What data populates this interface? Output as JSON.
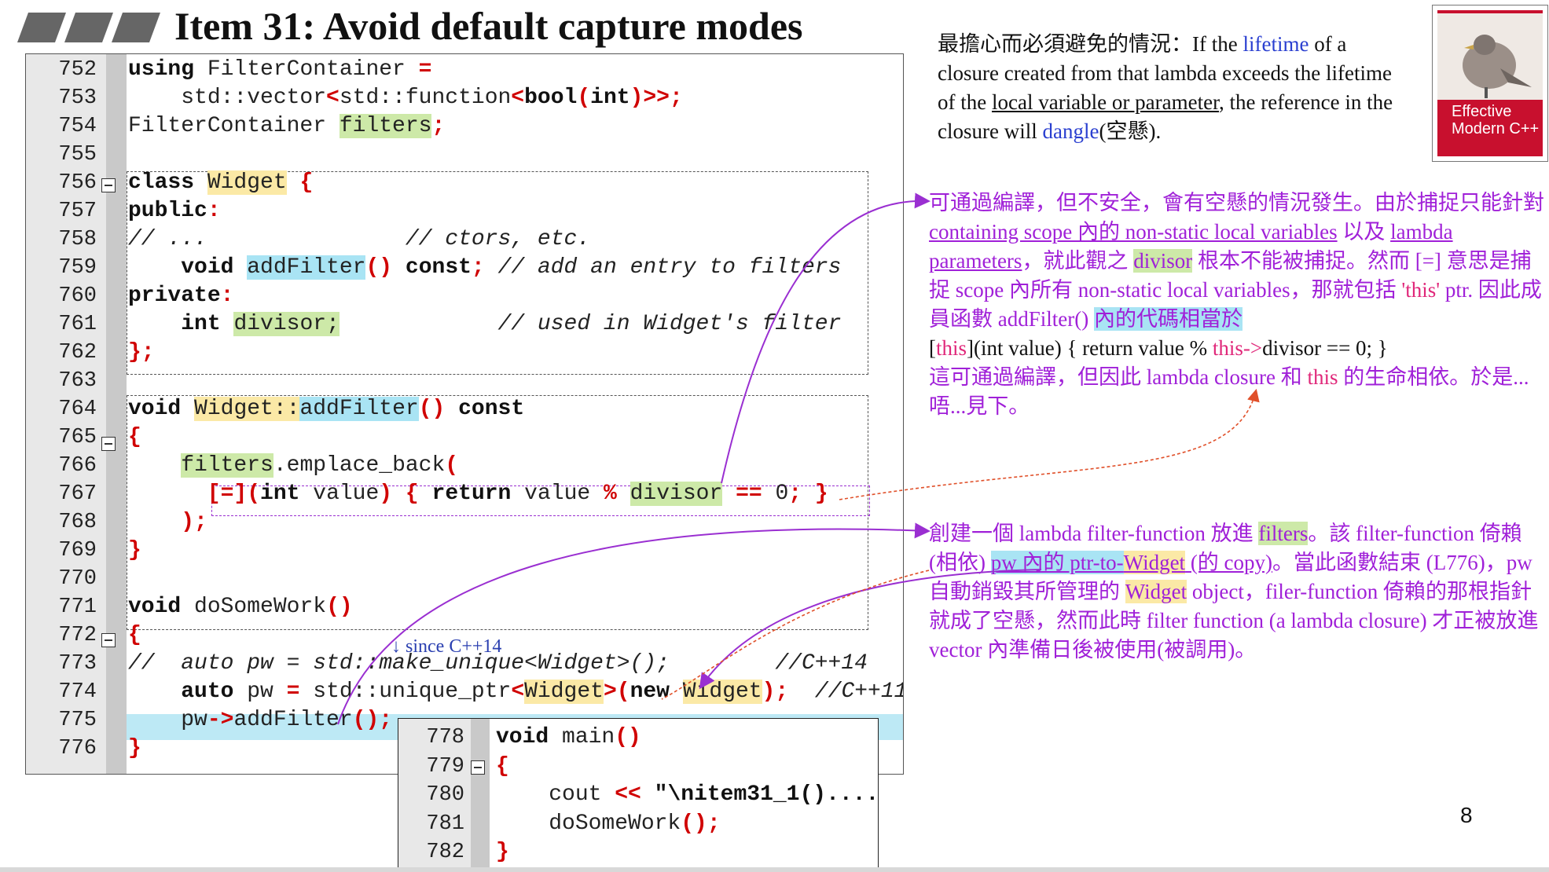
{
  "slide": {
    "title": "Item 31: Avoid default capture modes",
    "page_number": "8"
  },
  "code": {
    "lines": [
      {
        "n": "752",
        "segs": [
          {
            "t": "using",
            "c": "kw"
          },
          {
            "t": " FilterContainer "
          },
          {
            "t": "=",
            "c": "rd"
          }
        ]
      },
      {
        "n": "753",
        "segs": [
          {
            "t": "    std::vector"
          },
          {
            "t": "<",
            "c": "rd"
          },
          {
            "t": "std::function"
          },
          {
            "t": "<",
            "c": "rd"
          },
          {
            "t": "bool",
            "c": "kw"
          },
          {
            "t": "(",
            "c": "rd"
          },
          {
            "t": "int",
            "c": "kw"
          },
          {
            "t": ")>>;",
            "c": "rd"
          }
        ]
      },
      {
        "n": "754",
        "segs": [
          {
            "t": "FilterContainer "
          },
          {
            "t": "filters",
            "c": "hg"
          },
          {
            "t": ";",
            "c": "rd"
          }
        ]
      },
      {
        "n": "755",
        "segs": []
      },
      {
        "n": "756",
        "segs": [
          {
            "t": "class",
            "c": "kw"
          },
          {
            "t": " "
          },
          {
            "t": "Widget",
            "c": "hy"
          },
          {
            "t": " "
          },
          {
            "t": "{",
            "c": "rd"
          }
        ]
      },
      {
        "n": "757",
        "segs": [
          {
            "t": "public",
            "c": "kw"
          },
          {
            "t": ":",
            "c": "rd"
          }
        ]
      },
      {
        "n": "758",
        "segs": [
          {
            "t": "// ...               // ctors, etc.",
            "c": "cm"
          }
        ]
      },
      {
        "n": "759",
        "segs": [
          {
            "t": "    "
          },
          {
            "t": "void",
            "c": "kw"
          },
          {
            "t": " "
          },
          {
            "t": "addFilter",
            "c": "hc"
          },
          {
            "t": "()",
            "c": "rd"
          },
          {
            "t": " "
          },
          {
            "t": "const",
            "c": "kw"
          },
          {
            "t": ";",
            "c": "rd"
          },
          {
            "t": " // add an entry to filters",
            "c": "cm"
          }
        ]
      },
      {
        "n": "760",
        "segs": [
          {
            "t": "private",
            "c": "kw"
          },
          {
            "t": ":",
            "c": "rd"
          }
        ]
      },
      {
        "n": "761",
        "segs": [
          {
            "t": "    "
          },
          {
            "t": "int",
            "c": "kw"
          },
          {
            "t": " "
          },
          {
            "t": "divisor;",
            "c": "hg"
          },
          {
            "t": "            // used in Widget's filter",
            "c": "cm"
          }
        ]
      },
      {
        "n": "762",
        "segs": [
          {
            "t": "};",
            "c": "rd"
          }
        ]
      },
      {
        "n": "763",
        "segs": []
      },
      {
        "n": "764",
        "segs": [
          {
            "t": "void",
            "c": "kw"
          },
          {
            "t": " "
          },
          {
            "t": "Widget::",
            "c": "hy"
          },
          {
            "t": "addFilter",
            "c": "hc"
          },
          {
            "t": "()",
            "c": "rd"
          },
          {
            "t": " "
          },
          {
            "t": "const",
            "c": "kw"
          }
        ]
      },
      {
        "n": "765",
        "segs": [
          {
            "t": "{",
            "c": "rd"
          }
        ]
      },
      {
        "n": "766",
        "segs": [
          {
            "t": "    "
          },
          {
            "t": "filters",
            "c": "hg"
          },
          {
            "t": ".emplace_back"
          },
          {
            "t": "(",
            "c": "rd"
          }
        ]
      },
      {
        "n": "767",
        "segs": [
          {
            "t": "      "
          },
          {
            "t": "[=](",
            "c": "rd"
          },
          {
            "t": "int",
            "c": "kw"
          },
          {
            "t": " value"
          },
          {
            "t": ")",
            "c": "rd"
          },
          {
            "t": " "
          },
          {
            "t": "{",
            "c": "rd"
          },
          {
            "t": " "
          },
          {
            "t": "return",
            "c": "kw"
          },
          {
            "t": " value "
          },
          {
            "t": "%",
            "c": "rd"
          },
          {
            "t": " "
          },
          {
            "t": "divisor",
            "c": "hg"
          },
          {
            "t": " "
          },
          {
            "t": "==",
            "c": "rd"
          },
          {
            "t": " 0"
          },
          {
            "t": ";",
            "c": "rd"
          },
          {
            "t": " "
          },
          {
            "t": "}",
            "c": "rd"
          }
        ]
      },
      {
        "n": "768",
        "segs": [
          {
            "t": "    "
          },
          {
            "t": ");",
            "c": "rd"
          }
        ]
      },
      {
        "n": "769",
        "segs": [
          {
            "t": "}",
            "c": "rd"
          }
        ]
      },
      {
        "n": "770",
        "segs": []
      },
      {
        "n": "771",
        "segs": [
          {
            "t": "void",
            "c": "kw"
          },
          {
            "t": " doSomeWork"
          },
          {
            "t": "()",
            "c": "rd"
          }
        ]
      },
      {
        "n": "772",
        "segs": [
          {
            "t": "{",
            "c": "rd"
          }
        ]
      },
      {
        "n": "773",
        "segs": [
          {
            "t": "//  auto pw = std::make_unique<Widget>();        //C++14",
            "c": "cm"
          }
        ]
      },
      {
        "n": "774",
        "segs": [
          {
            "t": "    "
          },
          {
            "t": "auto",
            "c": "kw"
          },
          {
            "t": " pw "
          },
          {
            "t": "=",
            "c": "rd"
          },
          {
            "t": " std::unique_ptr"
          },
          {
            "t": "<",
            "c": "rd"
          },
          {
            "t": "Widget",
            "c": "hy"
          },
          {
            "t": ">(",
            "c": "rd"
          },
          {
            "t": "new",
            "c": "kw"
          },
          {
            "t": " "
          },
          {
            "t": "Widget",
            "c": "hy"
          },
          {
            "t": ");",
            "c": "rd"
          },
          {
            "t": "  //C++11",
            "c": "cm"
          }
        ]
      },
      {
        "n": "775",
        "segs": [
          {
            "t": "    pw"
          },
          {
            "t": "->",
            "c": "rd"
          },
          {
            "t": "addFilter"
          },
          {
            "t": "();",
            "c": "rd"
          }
        ]
      },
      {
        "n": "776",
        "segs": [
          {
            "t": "}",
            "c": "rd"
          }
        ]
      }
    ],
    "since_note": "↓ since C++14"
  },
  "main_code": {
    "lines": [
      {
        "n": "778",
        "segs": [
          {
            "t": "void",
            "c": "kw"
          },
          {
            "t": " main"
          },
          {
            "t": "()",
            "c": "rd"
          }
        ]
      },
      {
        "n": "779",
        "segs": [
          {
            "t": "{",
            "c": "rd"
          }
        ]
      },
      {
        "n": "780",
        "segs": [
          {
            "t": "    cout "
          },
          {
            "t": "<<",
            "c": "rd"
          },
          {
            "t": " "
          },
          {
            "t": "\"\\nitem31_1()....",
            "c": "kw"
          }
        ]
      },
      {
        "n": "781",
        "segs": [
          {
            "t": "    doSomeWork"
          },
          {
            "t": "();",
            "c": "rd"
          }
        ]
      },
      {
        "n": "782",
        "segs": [
          {
            "t": "}",
            "c": "rd"
          }
        ]
      }
    ]
  },
  "intro": {
    "lead": "最擔心而必須避免的情況：",
    "p1": "If the ",
    "lifetime": "lifetime",
    "p2": " of a closure created from that lambda exceeds the lifetime of the ",
    "local_var": "local variable or parameter",
    "p3": ", the reference in the closure will ",
    "dangle": "dangle",
    "p4": "(空懸)."
  },
  "note1": {
    "a": "可通過編譯，但不安全，會有空懸的情況發生。由於捕捉只能針對 ",
    "b": "containing scope 內的 non-static local variables",
    "c": " 以及 ",
    "d": "lambda parameters",
    "e": "，就此觀之 ",
    "f": "divisor",
    "g": " 根本不能被捕捉。然而 [=] 意思是捕捉 scope 內所有 non-static local variables，那就包括 ",
    "h": "'this'",
    "i": " ptr. 因此成員函數 addFilter() ",
    "j": "內的代碼相當於",
    "k1": "[",
    "k2": "this",
    "k3": "](int value) { return value % ",
    "k4": "this->",
    "k5": "divisor == 0; }",
    "l": "這可通過編譯，但因此 lambda closure 和 ",
    "m": "this",
    "n": " 的生命相依。於是...唔...見下。"
  },
  "note2": {
    "a": "創建一個 lambda filter-function 放進 ",
    "b": "filters",
    "c": "。該 filter-function 倚賴(相依) ",
    "d": "pw 內的 ptr-to-",
    "e": "Widget",
    "f": " (的 copy)",
    "g": "。當此函數結束 (L776)，pw 自動銷毀其所管理的 ",
    "h": "Widget",
    "i": " object，filer-function 倚賴的那根指針就成了空懸，然而此時 filter function (a lambda closure) 才正被放進 vector 內準備日後被使用(被調用)。"
  },
  "book": {
    "title_line1": "Effective",
    "title_line2": "Modern C++"
  }
}
